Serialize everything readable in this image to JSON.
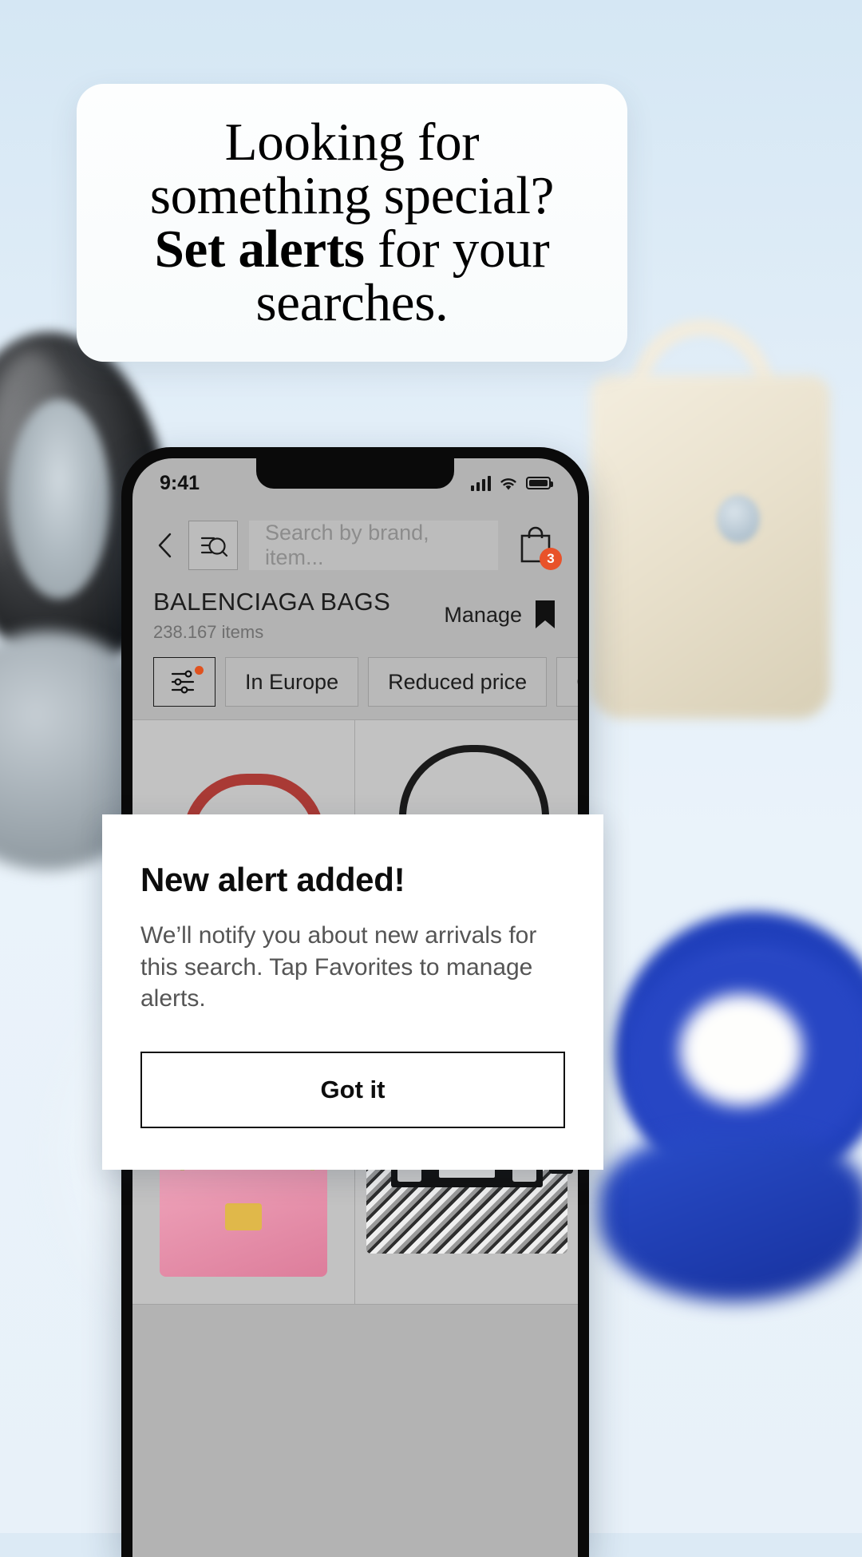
{
  "headline": {
    "line1": "Looking for",
    "line2": "something special?",
    "bold": "Set alerts",
    "line3_rest": " for your",
    "line4": "searches."
  },
  "phone": {
    "status_bar": {
      "time": "9:41",
      "signal_icon": "cellular-signal-icon",
      "wifi_icon": "wifi-icon",
      "battery_icon": "battery-icon"
    },
    "search_row": {
      "back_icon": "back-chevron-icon",
      "filter_search_icon": "filter-search-icon",
      "placeholder": "Search by brand, item...",
      "cart_icon": "shopping-bag-icon",
      "cart_badge": "3"
    },
    "title_row": {
      "title": "BALENCIAGA BAGS",
      "count": "238.167 items",
      "manage_label": "Manage",
      "bookmark_icon": "bookmark-filled-icon"
    },
    "chips": [
      {
        "label": "",
        "icon": "filter-sliders-icon",
        "has_dot": true
      },
      {
        "label": "In Europe",
        "icon": "",
        "has_dot": false
      },
      {
        "label": "Reduced price",
        "icon": "",
        "has_dot": false
      },
      {
        "label": "Condition",
        "icon": "",
        "has_dot": false
      }
    ],
    "products": [
      {
        "name": "red-tote-bag"
      },
      {
        "name": "black-crossbody-bag"
      },
      {
        "name": "pink-shoulder-bag"
      },
      {
        "name": "snakeskin-flap-bag"
      }
    ]
  },
  "modal": {
    "title": "New alert added!",
    "body": "We’ll notify you about new arrivals for this search. Tap Favorites to manage alerts.",
    "button_label": "Got it"
  },
  "colors": {
    "background": "#dceaf5",
    "badge_orange": "#e8522a",
    "chip_dot_orange": "#e0521f",
    "modal_bg": "#ffffff",
    "screen_gray": "#b3b3b3"
  }
}
